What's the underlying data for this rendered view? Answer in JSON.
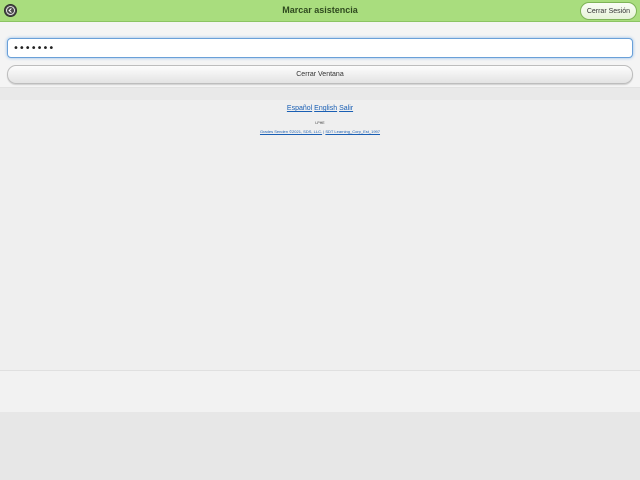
{
  "header": {
    "title": "Marcar asistencia",
    "logout_label": "Cerrar Sesión",
    "back_icon": "back-arrow-icon",
    "accent_color": "#a9dd7e"
  },
  "form": {
    "password_value": "•••••••",
    "close_window_label": "Cerrar Ventana"
  },
  "footer": {
    "languages": {
      "spanish": "Español",
      "english": "English",
      "exit": "Salir"
    },
    "small_tag": "LPHE",
    "copyright_left": "Grades Senden ©2021, SDS, LLC.",
    "separator": "|",
    "copyright_right": "SDT Learning_Corp_Est_1997"
  }
}
